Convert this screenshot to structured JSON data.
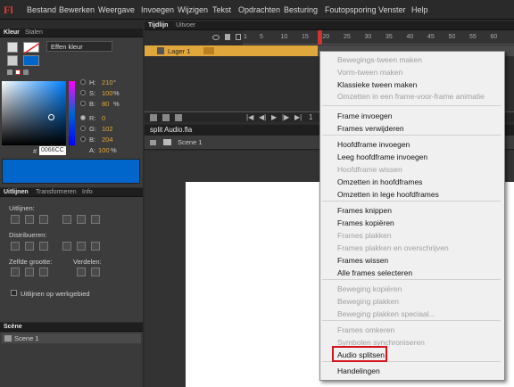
{
  "app": {
    "logo": "Fl"
  },
  "menubar": [
    "Bestand",
    "Bewerken",
    "Weergave",
    "Invoegen",
    "Wijzigen",
    "Tekst",
    "Opdrachten",
    "Besturing",
    "Foutopsporing",
    "Venster",
    "Help"
  ],
  "color_panel": {
    "tabs": [
      "Kleur",
      "Stalen"
    ],
    "fill_type": "Effen kleur",
    "H": "210",
    "S": "100",
    "B": "80",
    "R": "0",
    "G": "102",
    "Bb": "204",
    "A": "100",
    "hex": "0066CC",
    "labels": {
      "H": "H:",
      "S": "S:",
      "B": "B:",
      "R": "R:",
      "G": "G:",
      "Bb": "B:",
      "A": "A:",
      "hash": "#",
      "pct1": "%",
      "pct2": "%",
      "pct3": "%",
      "deg": "°"
    },
    "swatch_color": "#0066cc"
  },
  "align_panel": {
    "tabs": [
      "Uitlijnen",
      "Transformeren",
      "Info"
    ],
    "uitlijnen": "Uitlijnen:",
    "distribueren": "Distribueren:",
    "zelfde": "Zelfde grootte:",
    "verdelen": "Verdelen:",
    "workarea": "Uitlijnen op werkgebied"
  },
  "scene_panel": {
    "tab": "Scène",
    "item": "Scene 1"
  },
  "timeline": {
    "tabs": [
      "Tijdlijn",
      "Uitvoer"
    ],
    "layer": "Lager 1",
    "ruler": [
      "1",
      "5",
      "10",
      "15",
      "20",
      "25",
      "30",
      "35",
      "40",
      "45",
      "50",
      "55",
      "60"
    ],
    "frame_number": "1"
  },
  "document": {
    "tab": "split Audio.fla",
    "scene": "Scene 1"
  },
  "context_menu": {
    "items": [
      {
        "label": "Bewegings-tween maken",
        "disabled": true
      },
      {
        "label": "Vorm-tween maken",
        "disabled": true
      },
      {
        "label": "Klassieke tween maken",
        "disabled": false
      },
      {
        "label": "Omzetten in een frame-voor-frame animatie",
        "disabled": true
      },
      {
        "label": "Frame invoegen",
        "disabled": false
      },
      {
        "label": "Frames verwijderen",
        "disabled": false
      },
      {
        "label": "Hoofdframe invoegen",
        "disabled": false
      },
      {
        "label": "Leeg hoofdframe invoegen",
        "disabled": false
      },
      {
        "label": "Hoofdframe wissen",
        "disabled": true
      },
      {
        "label": "Omzetten in hoofdframes",
        "disabled": false
      },
      {
        "label": "Omzetten in lege hoofdframes",
        "disabled": false
      },
      {
        "label": "Frames knippen",
        "disabled": false
      },
      {
        "label": "Frames kopiëren",
        "disabled": false
      },
      {
        "label": "Frames plakken",
        "disabled": true
      },
      {
        "label": "Frames plakken en overschrijven",
        "disabled": true
      },
      {
        "label": "Frames wissen",
        "disabled": false
      },
      {
        "label": "Alle frames selecteren",
        "disabled": false
      },
      {
        "label": "Beweging kopiëren",
        "disabled": true
      },
      {
        "label": "Beweging plakken",
        "disabled": true
      },
      {
        "label": "Beweging plakken speciaal...",
        "disabled": true
      },
      {
        "label": "Frames omkeren",
        "disabled": true
      },
      {
        "label": "Symbolen synchroniseren",
        "disabled": true
      },
      {
        "label": "Audio splitsen",
        "disabled": false
      },
      {
        "label": "Handelingen",
        "disabled": false
      }
    ]
  }
}
